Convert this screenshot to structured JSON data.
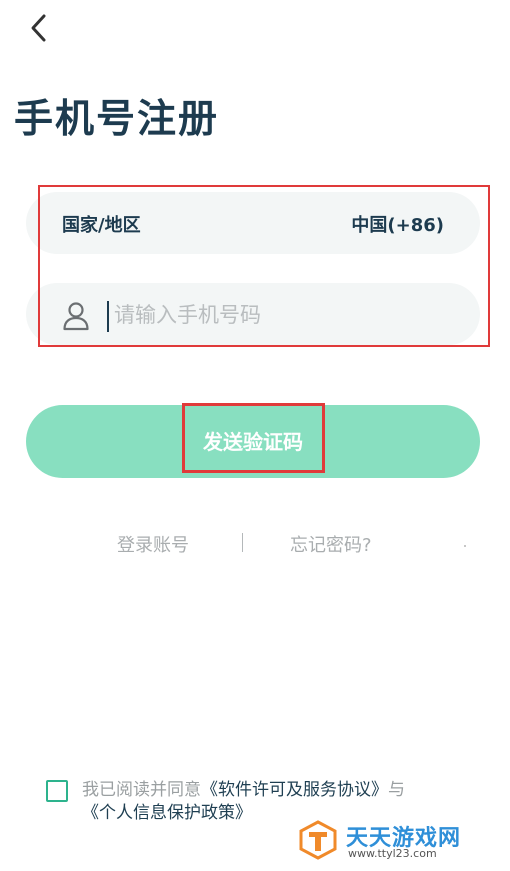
{
  "nav": {
    "back_icon": "chevron-left-icon"
  },
  "page_title": "手机号注册",
  "country": {
    "label": "国家/地区",
    "value": "中国(+86)"
  },
  "phone": {
    "icon": "user-icon",
    "placeholder": "请输入手机号码",
    "value": ""
  },
  "send_code_button": "发送验证码",
  "links": {
    "login": "登录账号",
    "forgot": "忘记密码?"
  },
  "agreement": {
    "prefix": "我已阅读并同意",
    "software_license": "《软件许可及服务协议》",
    "joiner": "与",
    "privacy_policy": "《个人信息保护政策》",
    "checked": false
  },
  "watermark": {
    "name": "天天游戏网",
    "url": "www.ttyl23.com"
  },
  "colors": {
    "title": "#1d3b4f",
    "button": "#88dfc0",
    "field_bg": "#f3f6f6",
    "highlight": "#e03a3a",
    "checkbox": "#2db38d",
    "watermark_orange": "#f08a2a",
    "watermark_blue": "#2f8fd8"
  }
}
